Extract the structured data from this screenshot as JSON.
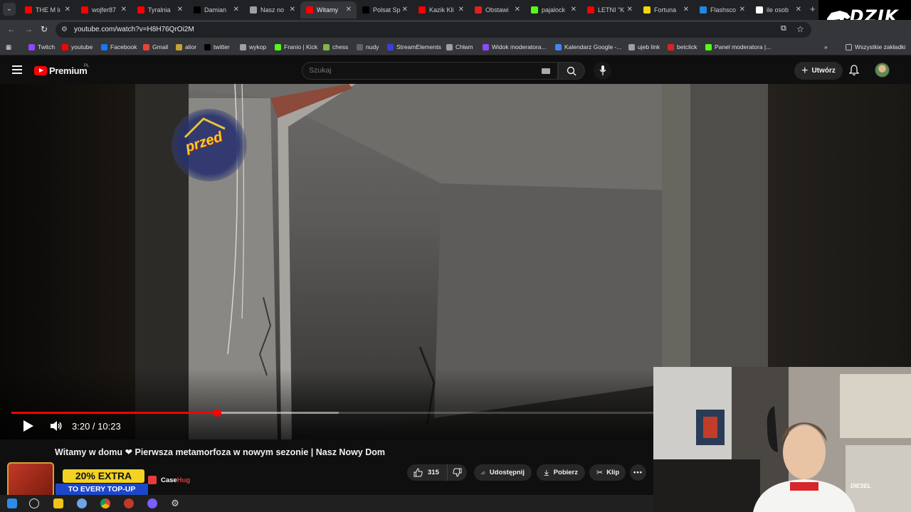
{
  "browser": {
    "tabs": [
      {
        "title": "THE M lı",
        "favicon": "youtube",
        "color": "#ff0000",
        "active": false
      },
      {
        "title": "wojfer87",
        "favicon": "youtube",
        "color": "#ff0000",
        "active": false
      },
      {
        "title": "Tyralnia",
        "favicon": "youtube",
        "color": "#ff0000",
        "active": false
      },
      {
        "title": "Damian",
        "favicon": "x",
        "color": "#000000",
        "active": false
      },
      {
        "title": "Nasz no",
        "favicon": "globe",
        "color": "#9aa0a6",
        "active": false
      },
      {
        "title": "Witamy",
        "favicon": "youtube",
        "color": "#ff0000",
        "active": true
      },
      {
        "title": "Polsat Sp",
        "favicon": "x",
        "color": "#000000",
        "active": false
      },
      {
        "title": "Kazik Kli",
        "favicon": "youtube",
        "color": "#ff0000",
        "active": false
      },
      {
        "title": "Obstawi",
        "favicon": "betclick",
        "color": "#e02020",
        "active": false
      },
      {
        "title": "pajalock",
        "favicon": "kick",
        "color": "#53fc18",
        "active": false
      },
      {
        "title": "LETNI \"K",
        "favicon": "youtube",
        "color": "#ff0000",
        "active": false
      },
      {
        "title": "Fortuna",
        "favicon": "fortuna",
        "color": "#f6d40a",
        "active": false
      },
      {
        "title": "Flashsco",
        "favicon": "flashscore",
        "color": "#1e88e5",
        "active": false
      },
      {
        "title": "ile osob",
        "favicon": "google",
        "color": "#ffffff",
        "active": false
      }
    ],
    "url": "youtube.com/watch?v=H8H76QrOi2M",
    "bookmarks": [
      {
        "label": "Twitch",
        "color": "#9146ff"
      },
      {
        "label": "youtube",
        "color": "#ff0000"
      },
      {
        "label": "Facebook",
        "color": "#1877f2"
      },
      {
        "label": "Gmail",
        "color": "#ea4335"
      },
      {
        "label": "alior",
        "color": "#c7a03a"
      },
      {
        "label": "twitter",
        "color": "#000000"
      },
      {
        "label": "wykop",
        "color": "#9aa0a6"
      },
      {
        "label": "Franio | Kick",
        "color": "#53fc18"
      },
      {
        "label": "chess",
        "color": "#81b64c"
      },
      {
        "label": "nudy",
        "color": "#5f6368"
      },
      {
        "label": "StreamElements",
        "color": "#3c3ce0"
      },
      {
        "label": "Chłam",
        "color": "#9aa0a6"
      },
      {
        "label": "Widok moderatora...",
        "color": "#9146ff"
      },
      {
        "label": "Kalendarz Google -...",
        "color": "#4285f4"
      },
      {
        "label": "ujeb link",
        "color": "#9aa0a6"
      },
      {
        "label": "betclick",
        "color": "#e02020"
      },
      {
        "label": "Panel moderatora |...",
        "color": "#53fc18"
      }
    ],
    "all_bookmarks": "Wszystkie zakładki"
  },
  "overlay_logo": "DZIK",
  "youtube": {
    "logo_text": "Premium",
    "logo_region": "PL",
    "search_placeholder": "Szukaj",
    "create_label": "Utwórz"
  },
  "player": {
    "current_time": "3:20",
    "duration": "10:23",
    "time_text": "3:20 / 10:23",
    "progress": 0.32,
    "buffered": 0.51,
    "sticker_text": "przed"
  },
  "video": {
    "title_part1": "Witamy w domu",
    "title_part2": "Pierwsza metamorfoza w nowym sezonie | Nasz Nowy Dom",
    "likes": "315",
    "share_label": "Udostępnij",
    "download_label": "Pobierz",
    "clip_label": "Klip"
  },
  "ad": {
    "line1": "20% EXTRA",
    "line2": "TO EVERY TOP-UP",
    "brand_part1": "Case",
    "brand_part2": "Hug"
  },
  "webcam": {
    "shirt_text": "DIESEL"
  }
}
